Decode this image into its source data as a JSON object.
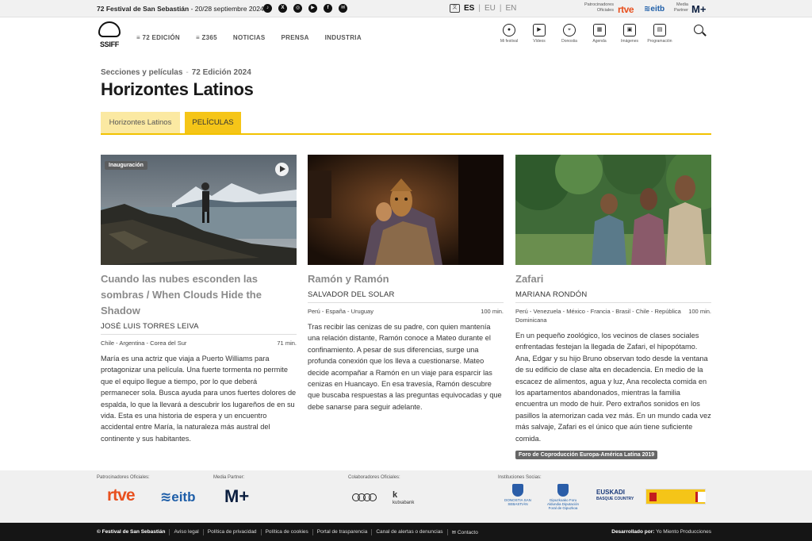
{
  "topbar": {
    "festival_name": "72 Festival de San Sebastián",
    "dates": " - 20/28 septiembre 2024",
    "socials": [
      {
        "icon": "tiktok-icon",
        "glyph": "♪"
      },
      {
        "icon": "x-icon",
        "glyph": "X"
      },
      {
        "icon": "instagram-icon",
        "glyph": "◎"
      },
      {
        "icon": "youtube-icon",
        "glyph": "▶"
      },
      {
        "icon": "facebook-icon",
        "glyph": "f"
      },
      {
        "icon": "newsletter-icon",
        "glyph": "✉"
      }
    ],
    "languages": [
      "ES",
      "EU",
      "EN"
    ],
    "lang_sep": "|",
    "official_sponsors_label": "Patrocinadores Oficiales",
    "media_partner_label": "Media Partner",
    "rtve": "rtve",
    "eitb": "eitb",
    "movistar": "M+"
  },
  "logo": {
    "text": "SSIFF"
  },
  "nav": {
    "items": [
      "≡ 72 EDICIÓN",
      "≡ Z365",
      "NOTICIAS",
      "PRENSA",
      "INDUSTRIA"
    ]
  },
  "tools": [
    {
      "label": "Mi festival",
      "icon": "user-icon",
      "glyph": "●"
    },
    {
      "label": "Vídeos",
      "icon": "video-icon",
      "glyph": "▶"
    },
    {
      "label": "Donostia",
      "icon": "map-pin-icon",
      "glyph": "⌖"
    },
    {
      "label": "Agenda",
      "icon": "calendar-icon",
      "glyph": "▦"
    },
    {
      "label": "Imágenes",
      "icon": "images-icon",
      "glyph": "▣"
    },
    {
      "label": "Programación",
      "icon": "schedule-icon",
      "glyph": "▤"
    }
  ],
  "breadcrumb": {
    "section": "Secciones y películas",
    "sep": "-",
    "edition": "72 Edición 2024"
  },
  "page_title": "Horizontes Latinos",
  "tabs": [
    "Horizontes Latinos",
    "PELÍCULAS"
  ],
  "films": [
    {
      "badge": "Inauguración",
      "title": "Cuando las nubes esconden las sombras / When Clouds Hide the Shadow",
      "director": "JOSÉ LUIS TORRES LEIVA",
      "countries": "Chile - Argentina - Corea del Sur",
      "duration": "71 min.",
      "synopsis": "María es una actriz que viaja a Puerto Williams para protagonizar una película. Una fuerte tormenta no permite que el equipo llegue a tiempo, por lo que deberá permanecer sola. Busca ayuda para unos fuertes dolores de espalda, lo que la llevará a descubrir los lugareños de en su vida. Esta es una historia de espera y un encuentro accidental entre María, la naturaleza más austral del continente y sus habitantes."
    },
    {
      "title": "Ramón y Ramón",
      "director": "SALVADOR DEL SOLAR",
      "countries": "Perú - España - Uruguay",
      "duration": "100 min.",
      "synopsis": "Tras recibir las cenizas de su padre, con quien mantenía una relación distante, Ramón conoce a Mateo durante el confinamiento. A pesar de sus diferencias, surge una profunda conexión que los lleva a cuestionarse. Mateo decide acompañar a Ramón en un viaje para esparcir las cenizas en Huancayo. En esa travesía, Ramón descubre que buscaba respuestas a las preguntas equivocadas y que debe sanarse para seguir adelante."
    },
    {
      "title": "Zafari",
      "director": "MARIANA RONDÓN",
      "countries": "Perú - Venezuela - México - Francia - Brasil - Chile - República Dominicana",
      "duration": "100 min.",
      "synopsis": "En un pequeño zoológico, los vecinos de clases sociales enfrentadas festejan la llegada de Zafari, el hipopótamo. Ana, Edgar y su hijo Bruno observan todo desde la ventana de su edificio de clase alta en decadencia. En medio de la escacez de alimentos, agua y luz, Ana recolecta comida en los apartamentos abandonados, mientras la familia encuentra un modo de huir. Pero extraños sonidos en los pasillos la atemorizan cada vez más. En un mundo cada vez más salvaje, Zafari es el único que aún tiene suficiente comida.",
      "tag": "Foro de Coproducción Europa-América Latina 2019"
    }
  ],
  "footer": {
    "official_sponsors": "Patrocinadores Oficiales:",
    "media_partner": "Media Partner:",
    "collaborators": "Colaboradores Oficiales:",
    "institutions": "Instituciones Socias:",
    "rtve": "rtve",
    "eitb": "eitb",
    "movistar": "M+",
    "kutxa_top": "k",
    "kutxa": "kutxabank",
    "donostia": "DONOSTIA SAN SEBASTIÁN",
    "gipuzkoa": "Gipuzkoako Foru Aldundia Diputación Foral de Gipuzkoa",
    "euskadi": "EUSKADI",
    "euskadi_sub": "BASQUE COUNTRY"
  },
  "bottom": {
    "links": [
      "© Festival de San Sebastián",
      "Aviso legal",
      "Política de privacidad",
      "Política de cookies",
      "Portal de trasparencia",
      "Canal de alertas o denuncias",
      "✉ Contacto"
    ],
    "dev_label": "Desarrollado por:",
    "dev_name": "Yo Miento Producciones"
  }
}
